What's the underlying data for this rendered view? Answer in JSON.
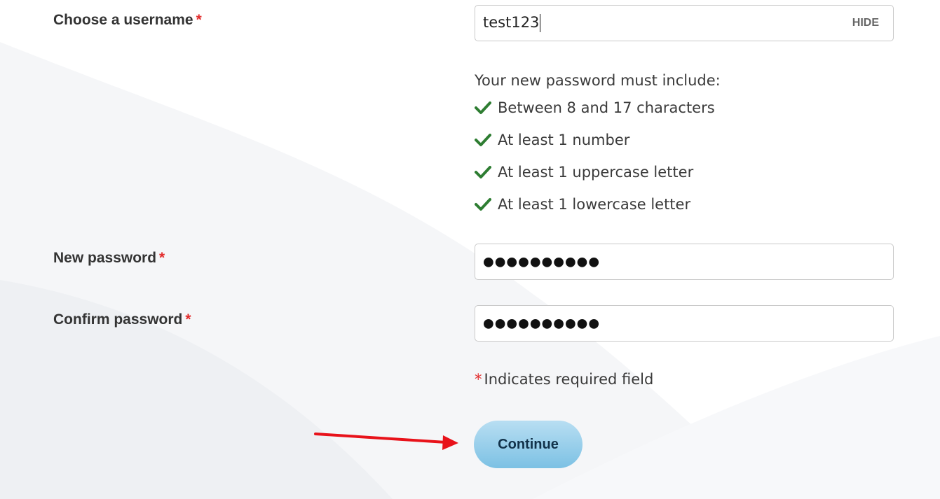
{
  "form": {
    "username": {
      "label": "Choose a username",
      "required_mark": "*",
      "value": "test123",
      "toggle_label": "HIDE"
    },
    "password_rules": {
      "title": "Your new password must include:",
      "items": [
        "Between 8 and 17 characters",
        "At least 1 number",
        "At least 1 uppercase letter",
        "At least 1 lowercase letter"
      ],
      "status": "satisfied",
      "icon": "checkmark-icon",
      "color": "#2e7d32"
    },
    "new_password": {
      "label": "New password",
      "required_mark": "*",
      "masked_value": "●●●●●●●●●●"
    },
    "confirm_password": {
      "label": "Confirm password",
      "required_mark": "*",
      "masked_value": "●●●●●●●●●●"
    },
    "required_note": {
      "star": "*",
      "text": "Indicates required field"
    },
    "continue_label": "Continue"
  },
  "colors": {
    "required_star": "#e22b2b",
    "button_top": "#b8def2",
    "button_bottom": "#7cc1e4",
    "annotation_arrow": "#e8121a"
  }
}
